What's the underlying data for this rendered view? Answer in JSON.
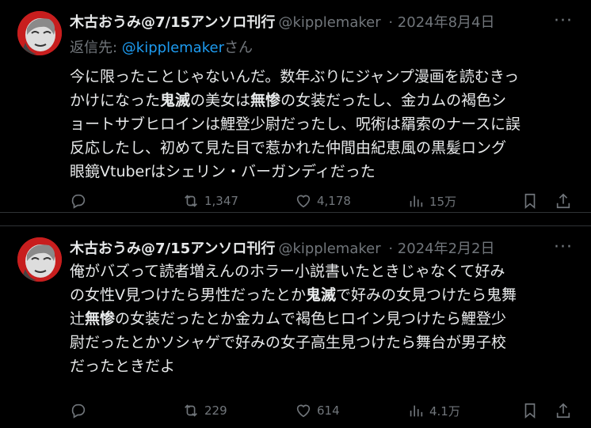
{
  "tweets": [
    {
      "author_name": "木古おうみ@7/15アンソロ刊行",
      "handle": "@kipplemaker",
      "date": "2024年8月4日",
      "reply_prefix": "返信先: ",
      "reply_mention": "@kipplemaker",
      "reply_suffix": "さん",
      "text_lines": [
        [
          {
            "t": "今に限ったことじゃないんだ。数年ぶりにジャンプ漫画を読むきっ"
          }
        ],
        [
          {
            "t": "かけになった"
          },
          {
            "t": "鬼滅",
            "b": true
          },
          {
            "t": "の美女は"
          },
          {
            "t": "無惨",
            "b": true
          },
          {
            "t": "の女装だったし、金カムの褐色シ"
          }
        ],
        [
          {
            "t": "ョートサブヒロインは鯉登少尉だったし、呪術は羂索のナースに誤"
          }
        ],
        [
          {
            "t": "反応したし、初めて見た目で惹かれた仲間由紀恵風の黒髪ロング"
          }
        ],
        [
          {
            "t": "眼鏡Vtuberはシェリン・バーガンディだった"
          }
        ]
      ],
      "stats": {
        "reposts": "1,347",
        "likes": "4,178",
        "views": "15万"
      }
    },
    {
      "author_name": "木古おうみ@7/15アンソロ刊行",
      "handle": "@kipplemaker",
      "date": "2024年2月2日",
      "text_lines": [
        [
          {
            "t": "俺がバズって読者増えんのホラー小説書いたときじゃなくて好み"
          }
        ],
        [
          {
            "t": "の女性V見つけたら男性だったとか"
          },
          {
            "t": "鬼滅",
            "b": true
          },
          {
            "t": "で好みの女見つけたら鬼舞"
          }
        ],
        [
          {
            "t": "辻"
          },
          {
            "t": "無惨",
            "b": true
          },
          {
            "t": "の女装だったとか金カムで褐色ヒロイン見つけたら鯉登少"
          }
        ],
        [
          {
            "t": "尉だったとかソシャゲで好みの女子高生見つけたら舞台が男子校"
          }
        ],
        [
          {
            "t": "だったときだよ"
          }
        ]
      ],
      "stats": {
        "reposts": "229",
        "likes": "614",
        "views": "4.1万"
      }
    }
  ],
  "icons": [
    "reply-icon",
    "repost-icon",
    "like-icon",
    "views-icon",
    "bookmark-icon",
    "share-icon",
    "more-icon"
  ],
  "colors": {
    "background": "#000000",
    "text": "#e7e9ea",
    "muted": "#71767b",
    "link": "#1d9bf0",
    "divider": "#2f3336"
  }
}
